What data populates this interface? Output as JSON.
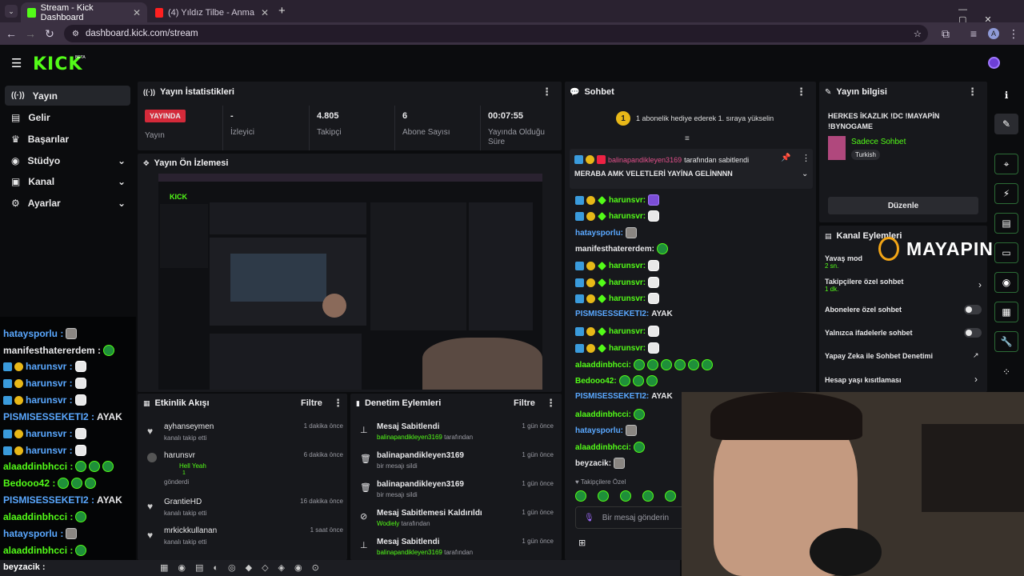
{
  "browser": {
    "tabs": [
      {
        "label": "Stream - Kick Dashboard"
      },
      {
        "label": "(4) Yıldız Tilbe - Anma Arkadaş"
      }
    ],
    "new_tab": "+",
    "url": "dashboard.kick.com/stream",
    "profile": "A"
  },
  "brand": {
    "logo": "KICK",
    "beta": "BETA",
    "accent": "#53fc18"
  },
  "sidebar": {
    "items": [
      {
        "label": "Yayın",
        "icon": "broadcast-icon"
      },
      {
        "label": "Gelir",
        "icon": "wallet-icon"
      },
      {
        "label": "Başarılar",
        "icon": "trophy-icon"
      },
      {
        "label": "Stüdyo",
        "icon": "studio-icon"
      },
      {
        "label": "Kanal",
        "icon": "channel-icon"
      },
      {
        "label": "Ayarlar",
        "icon": "settings-icon"
      }
    ]
  },
  "stats": {
    "title": "Yayın İstatistikleri",
    "live_badge": "YAYINDA",
    "cells": [
      {
        "value": "",
        "label": "Yayın"
      },
      {
        "value": "-",
        "label": "İzleyici"
      },
      {
        "value": "4.805",
        "label": "Takipçi"
      },
      {
        "value": "6",
        "label": "Abone Sayısı"
      },
      {
        "value": "00:07:55",
        "label": "Yayında Olduğu Süre"
      }
    ]
  },
  "preview": {
    "title": "Yayın Ön İzlemesi"
  },
  "activity": {
    "title": "Etkinlik Akışı",
    "filter": "Filtre",
    "items": [
      {
        "name": "ayhanseymen",
        "sub": "kanalı takip etti",
        "time": "1 dakika önce"
      },
      {
        "name": "harunsvr",
        "sub": "Hell Yeah",
        "sub2": "1",
        "sub3": "gönderdi",
        "time": "6 dakika önce"
      },
      {
        "name": "GrantieHD",
        "sub": "kanalı takip etti",
        "time": "16 dakika önce"
      },
      {
        "name": "mrkickkullanan",
        "sub": "kanalı takip etti",
        "time": "1 saat önce"
      }
    ]
  },
  "moderation": {
    "title": "Denetim Eylemleri",
    "filter": "Filtre",
    "items": [
      {
        "title": "Mesaj Sabitlendi",
        "user": "balinapandikleyen3169",
        "rest": "tarafından",
        "time": "1 gün önce"
      },
      {
        "title": "balinapandikleyen3169",
        "user": "",
        "rest": "bir mesajı sildi",
        "time": "1 gün önce"
      },
      {
        "title": "balinapandikleyen3169",
        "user": "",
        "rest": "bir mesajı sildi",
        "time": "1 gün önce"
      },
      {
        "title": "Mesaj Sabitlemesi Kaldırıldı",
        "user": "Wodiely",
        "rest": "tarafından",
        "time": "1 gün önce"
      },
      {
        "title": "Mesaj Sabitlendi",
        "user": "balinapandikleyen3169",
        "rest": "tarafından",
        "time": "1 gün önce"
      }
    ]
  },
  "chat": {
    "title": "Sohbet",
    "gift_badge": "1",
    "gift_text": "1 abonelik hediye ederek 1. sıraya yükselin",
    "pinned_by": "balinapandikleyen3169",
    "pinned_suffix": "tarafından sabitlendi",
    "pinned_message": "MERABA AMK VELETLERİ YAYİNA GELİNNNN",
    "messages": [
      {
        "user": "harunsvr:",
        "text": ""
      },
      {
        "user": "harunsvr:",
        "text": ""
      },
      {
        "user": "hataysporlu:",
        "text": ""
      },
      {
        "user": "manifesthatererdem:",
        "text": ""
      },
      {
        "user": "harunsvr:",
        "text": ""
      },
      {
        "user": "harunsvr:",
        "text": ""
      },
      {
        "user": "harunsvr:",
        "text": ""
      },
      {
        "user": "PISMISESSEKETI2:",
        "text": "AYAK"
      },
      {
        "user": "harunsvr:",
        "text": ""
      },
      {
        "user": "harunsvr:",
        "text": ""
      },
      {
        "user": "alaaddinbhcci:",
        "text": ""
      },
      {
        "user": "Bedooo42:",
        "text": ""
      },
      {
        "user": "PISMISESSEKETI2:",
        "text": "AYAK"
      },
      {
        "user": "alaaddinbhcci:",
        "text": ""
      },
      {
        "user": "hataysporlu:",
        "text": ""
      },
      {
        "user": "alaaddinbhcci:",
        "text": ""
      },
      {
        "user": "beyzacik:",
        "text": ""
      }
    ],
    "followers_only": "Takipçilere Özel",
    "input_placeholder": "Bir mesaj gönderin"
  },
  "stream_info": {
    "title": "Yayın bilgisi",
    "stream_title": "HERKES İKAZLIK !DC !MAYAPİN !BYNOGAME",
    "category": "Sadece Sohbet",
    "language": "Turkish",
    "edit_button": "Düzenle"
  },
  "channel_actions": {
    "title": "Kanal Eylemleri",
    "items": [
      {
        "label": "Yavaş mod",
        "value": "2 sn."
      },
      {
        "label": "Takipçilere özel sohbet",
        "value": "1 dk."
      },
      {
        "label": "Abonelere özel sohbet",
        "value": ""
      },
      {
        "label": "Yalnızca ifadelerle sohbet",
        "value": ""
      },
      {
        "label": "Yapay Zeka ile Sohbet Denetimi",
        "value": ""
      },
      {
        "label": "Hesap yaşı kısıtlaması",
        "value": ""
      }
    ]
  },
  "overlay_logo": "MAYAPIN",
  "overlay_chat": [
    {
      "user": "hataysporlu :",
      "text": ""
    },
    {
      "user": "manifesthatererdem :",
      "text": ""
    },
    {
      "user": "harunsvr :",
      "text": ""
    },
    {
      "user": "harunsvr :",
      "text": ""
    },
    {
      "user": "harunsvr :",
      "text": ""
    },
    {
      "user": "PISMISESSEKETI2 :",
      "text": "AYAK"
    },
    {
      "user": "harunsvr :",
      "text": ""
    },
    {
      "user": "harunsvr :",
      "text": ""
    },
    {
      "user": "alaaddinbhcci :",
      "text": ""
    },
    {
      "user": "Bedooo42 :",
      "text": ""
    },
    {
      "user": "PISMISESSEKETI2 :",
      "text": "AYAK"
    },
    {
      "user": "alaaddinbhcci :",
      "text": ""
    },
    {
      "user": "hataysporlu :",
      "text": ""
    },
    {
      "user": "alaaddinbhcci :",
      "text": ""
    },
    {
      "user": "beyzacik :",
      "text": ""
    }
  ]
}
